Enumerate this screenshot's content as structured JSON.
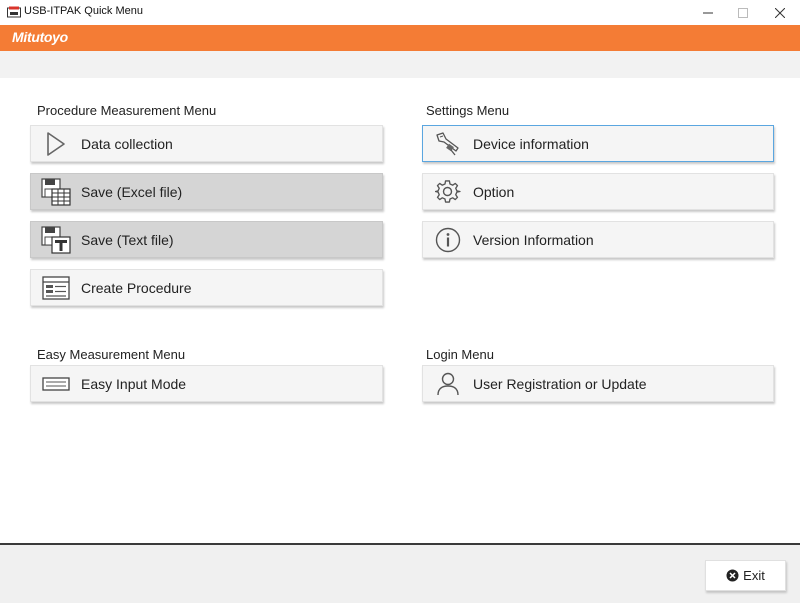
{
  "window": {
    "title": "USB-ITPAK Quick Menu",
    "minimize_icon": "minimize-icon",
    "maximize_icon": "maximize-icon",
    "close_icon": "close-icon"
  },
  "brand": {
    "logo_text": "Mitutoyo",
    "color": "#f47c35"
  },
  "procedure_menu": {
    "title": "Procedure Measurement Menu",
    "items": [
      {
        "label": "Data collection",
        "icon": "play-icon",
        "state": "normal"
      },
      {
        "label": "Save (Excel file)",
        "icon": "save-excel-icon",
        "state": "pressed"
      },
      {
        "label": "Save (Text file)",
        "icon": "save-text-icon",
        "state": "pressed"
      },
      {
        "label": "Create Procedure",
        "icon": "procedure-list-icon",
        "state": "normal"
      }
    ]
  },
  "settings_menu": {
    "title": "Settings Menu",
    "items": [
      {
        "label": "Device information",
        "icon": "caliper-icon",
        "state": "focused"
      },
      {
        "label": "Option",
        "icon": "gear-icon",
        "state": "normal"
      },
      {
        "label": "Version Information",
        "icon": "info-icon",
        "state": "normal"
      }
    ]
  },
  "easy_menu": {
    "title": "Easy Measurement Menu",
    "items": [
      {
        "label": "Easy Input Mode",
        "icon": "input-field-icon",
        "state": "normal"
      }
    ]
  },
  "login_menu": {
    "title": "Login Menu",
    "items": [
      {
        "label": "User Registration or Update",
        "icon": "user-icon",
        "state": "normal"
      }
    ]
  },
  "footer": {
    "exit_label": "Exit",
    "exit_icon": "close-circle-icon"
  }
}
